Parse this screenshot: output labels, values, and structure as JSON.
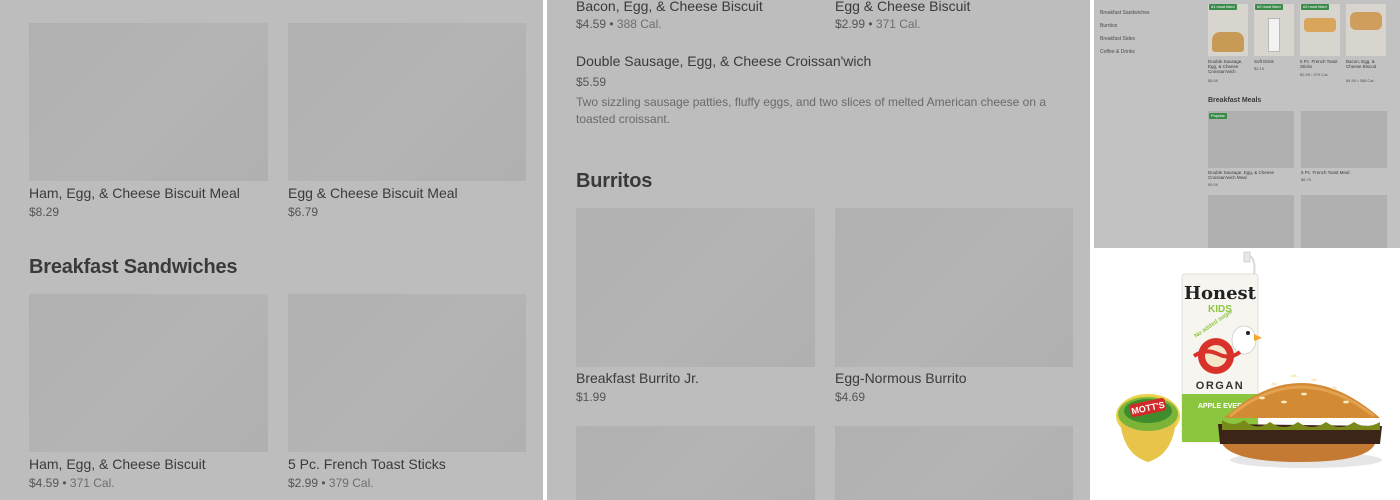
{
  "left": {
    "row1": [
      {
        "name": "Ham, Egg, & Cheese Biscuit Meal",
        "price": "$8.29"
      },
      {
        "name": "Egg & Cheese Biscuit Meal",
        "price": "$6.79"
      }
    ],
    "section": "Breakfast Sandwiches",
    "row2": [
      {
        "name": "Ham, Egg, & Cheese Biscuit",
        "price": "$4.59",
        "cal": "371 Cal."
      },
      {
        "name": "5 Pc. French Toast Sticks",
        "price": "$2.99",
        "cal": "379 Cal."
      }
    ]
  },
  "mid": {
    "top": [
      {
        "name": "Bacon, Egg, & Cheese Biscuit",
        "price": "$4.59",
        "cal": "388 Cal."
      },
      {
        "name": "Egg & Cheese Biscuit",
        "price": "$2.99",
        "cal": "371 Cal."
      }
    ],
    "featured": {
      "name": "Double Sausage, Egg, & Cheese Croissan'wich",
      "price": "$5.59",
      "desc": "Two sizzling sausage patties, fluffy eggs, and two slices of melted American cheese on a toasted croissant."
    },
    "section": "Burritos",
    "row": [
      {
        "name": "Breakfast Burrito Jr.",
        "price": "$1.99"
      },
      {
        "name": "Egg-Normous Burrito",
        "price": "$4.69"
      }
    ]
  },
  "right": {
    "sidebar": [
      "Breakfast Sandwiches",
      "Burritos",
      "Breakfast Sides",
      "Coffee & Drinks"
    ],
    "badges": [
      "#1 most liked",
      "#2 most liked",
      "#3 most liked"
    ],
    "items": [
      {
        "name": "Double Sausage, Egg, & Cheese Croissan'wich",
        "price": "$5.59"
      },
      {
        "name": "Soft Drink",
        "price": "$2.19"
      },
      {
        "name": "5 Pc. French Toast Sticks",
        "price": "$2.99",
        "cal": "379 Cal."
      },
      {
        "name": "Bacon, Egg, & Cheese Biscuit",
        "price": "$4.59",
        "cal": "388 Cal."
      }
    ],
    "meals_heading": "Breakfast Meals",
    "meals_badge": "Popular",
    "meals": [
      {
        "name": "Double Sausage, Egg, & Cheese Croissan'wich Meal",
        "price": "$9.09"
      },
      {
        "name": "5 Pc. French Toast Meal",
        "price": "$6.79"
      }
    ]
  },
  "food": {
    "brand": "Honest",
    "sub": "KIDS",
    "tag": "No added sugar",
    "organic": "ORGAN",
    "juice": "APPLE EVER",
    "cup": "MOTT'S"
  },
  "colors": {
    "overlay": "#bdbdbd",
    "tile": "#b2b2b2",
    "badge": "#3a8a4a"
  }
}
